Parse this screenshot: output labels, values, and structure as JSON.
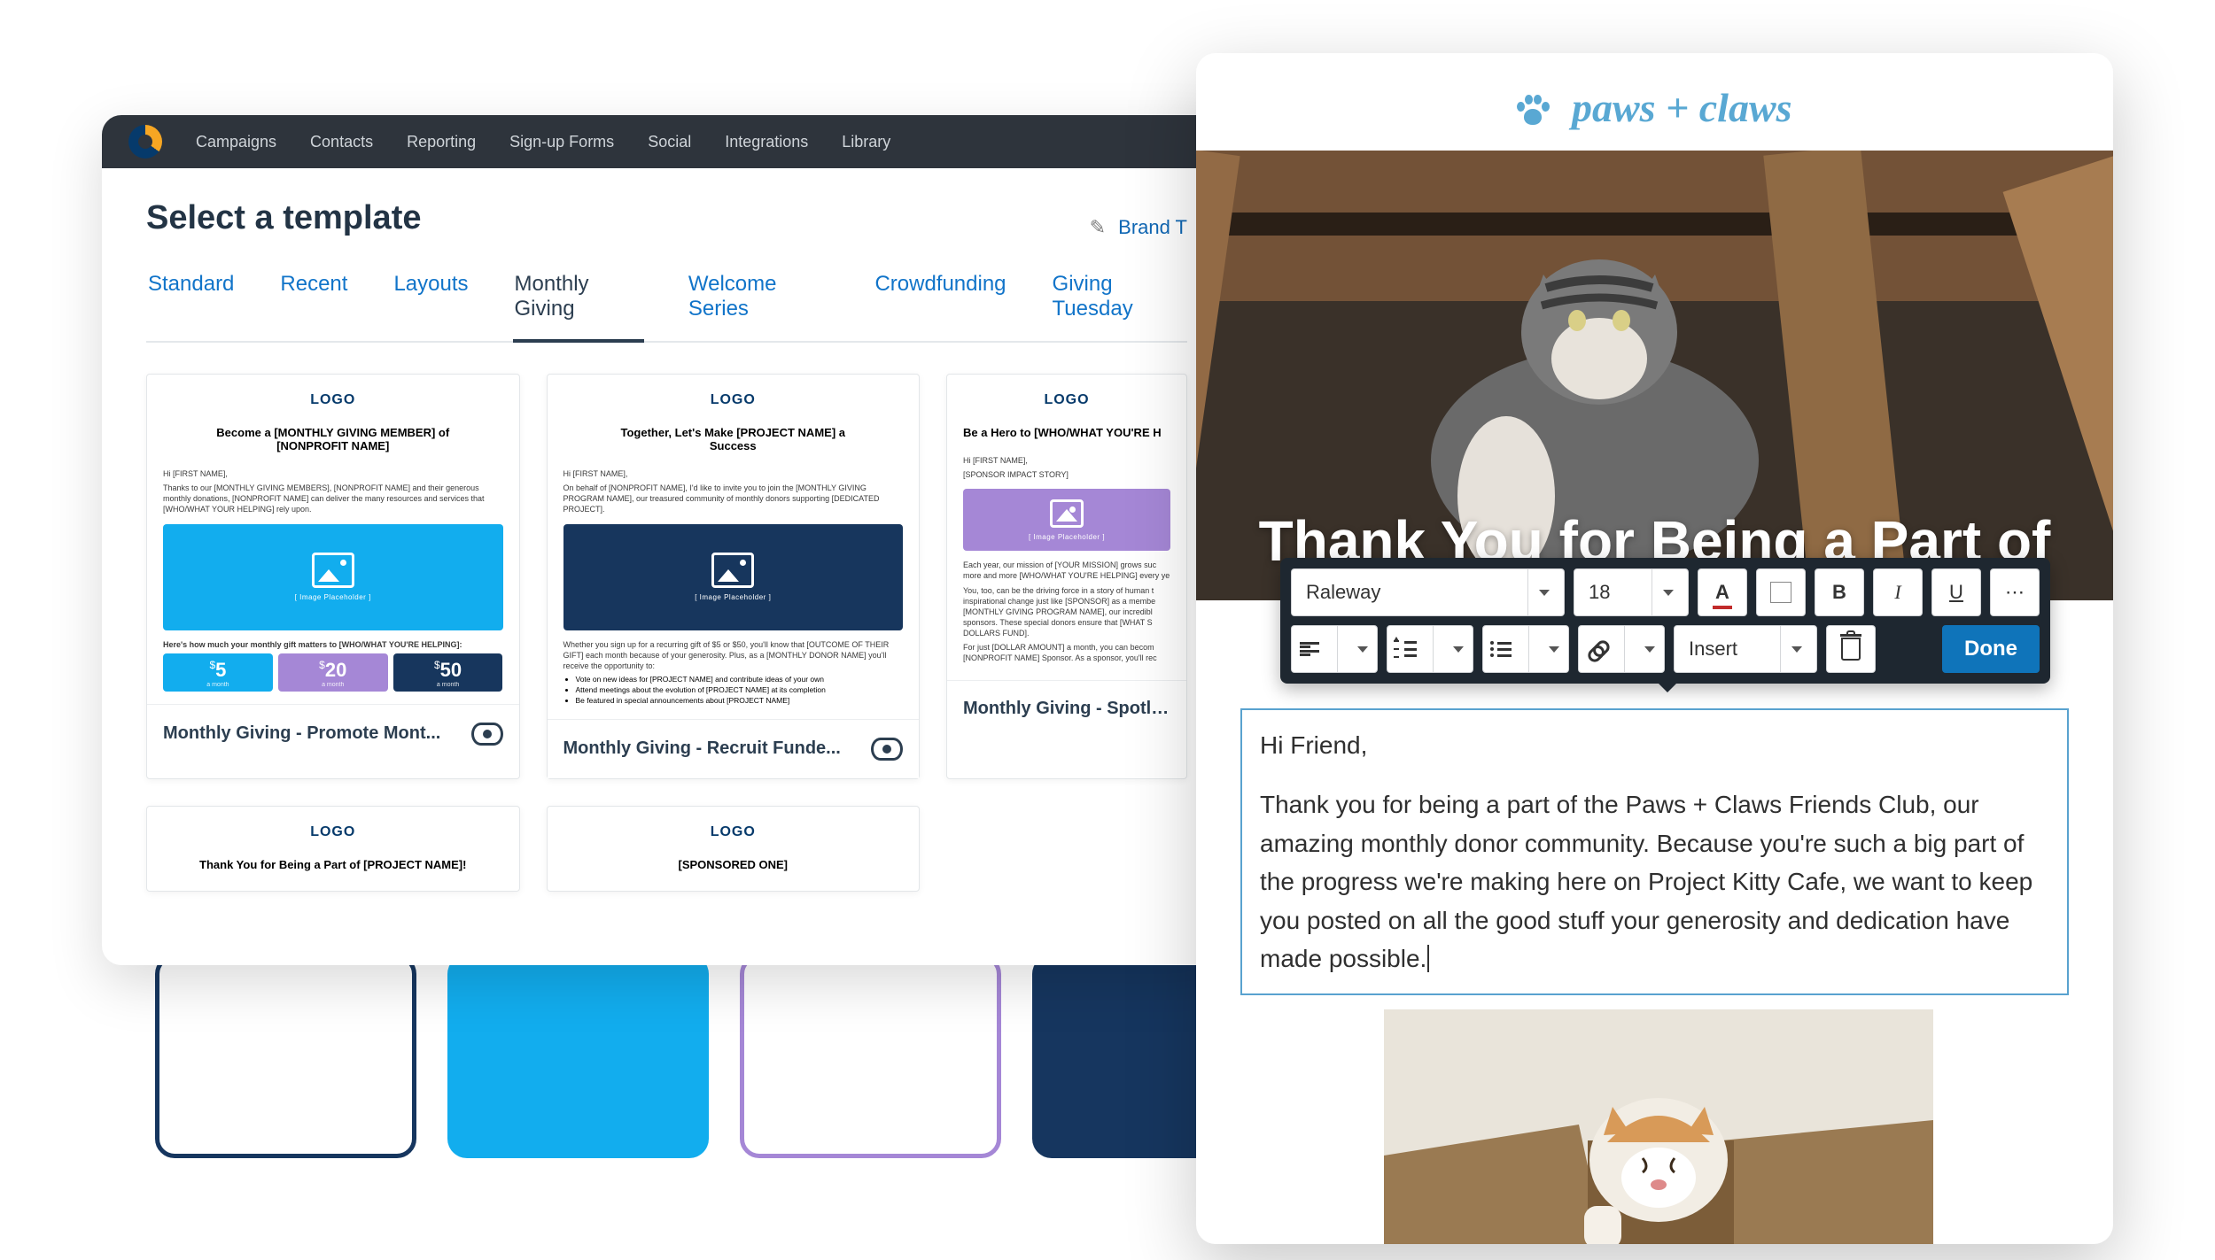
{
  "nav": {
    "items": [
      "Campaigns",
      "Contacts",
      "Reporting",
      "Sign-up Forms",
      "Social",
      "Integrations",
      "Library"
    ]
  },
  "picker": {
    "title": "Select a template",
    "brand_link": "Brand T",
    "tabs": [
      "Standard",
      "Recent",
      "Layouts",
      "Monthly Giving",
      "Welcome Series",
      "Crowdfunding",
      "Giving Tuesday"
    ],
    "active_tab": "Monthly Giving",
    "cards": [
      {
        "logo": "LOGO",
        "headline": "Become a [MONTHLY GIVING MEMBER] of [NONPROFIT NAME]",
        "greeting": "Hi [FIRST NAME],",
        "intro": "Thanks to our [MONTHLY GIVING MEMBERS], [NONPROFIT NAME] and their generous monthly donations, [NONPROFIT NAME] can deliver the many resources and services that [WHO/WHAT YOUR HELPING] rely upon.",
        "ph": "[ Image Placeholder ]",
        "sub": "Here's how much your monthly gift matters to [WHO/WHAT YOU'RE HELPING]:",
        "prices": [
          {
            "n": "5"
          },
          {
            "n": "20"
          },
          {
            "n": "50"
          }
        ],
        "price_unit": "a month",
        "name": "Monthly Giving - Promote Mont..."
      },
      {
        "logo": "LOGO",
        "headline": "Together, Let's Make [PROJECT NAME] a Success",
        "greeting": "Hi [FIRST NAME],",
        "intro": "On behalf of [NONPROFIT NAME], I'd like to invite you to join the [MONTHLY GIVING PROGRAM NAME], our treasured community of monthly donors supporting [DEDICATED PROJECT].",
        "ph": "[ Image Placeholder ]",
        "body": "Whether you sign up for a recurring gift of $5 or $50, you'll know that [OUTCOME OF THEIR GIFT] each month because of your generosity. Plus, as a [MONTHLY DONOR NAME] you'll receive the opportunity to:",
        "bullets": [
          "Vote on new ideas for [PROJECT NAME] and contribute ideas of your own",
          "Attend meetings about the evolution of [PROJECT NAME] at its completion",
          "Be featured in special announcements about [PROJECT NAME]"
        ],
        "name": "Monthly Giving - Recruit Funde..."
      },
      {
        "logo": "LOGO",
        "headline": "Be a Hero to [WHO/WHAT YOU'RE H",
        "greeting": "Hi [FIRST NAME],",
        "impact": "[SPONSOR IMPACT STORY]",
        "ph": "[ Image Placeholder ]",
        "body1": "Each year, our mission of [YOUR MISSION] grows suc more and more [WHO/WHAT YOU'RE HELPING] every ye",
        "body2": "You, too, can be the driving force in a story of human t inspirational change just like [SPONSOR] as a membe [MONTHLY GIVING PROGRAM NAME], our incredibl sponsors. These special donors ensure that [WHAT S DOLLARS FUND].",
        "body3": "For just [DOLLAR AMOUNT] a month, you can becom [NONPROFIT NAME] Sponsor. As a sponsor, you'll rec",
        "name": "Monthly Giving - Spotlight Spo"
      }
    ],
    "row2": [
      {
        "logo": "LOGO",
        "headline": "Thank You for Being a Part of [PROJECT NAME]!"
      },
      {
        "logo": "LOGO",
        "headline": "[SPONSORED ONE]"
      }
    ]
  },
  "editor": {
    "brand": "paws + claws",
    "hero_heading": "Thank You for Being a Part of",
    "toolbar": {
      "font": "Raleway",
      "size": "18",
      "insert": "Insert",
      "done": "Done",
      "bold": "B",
      "italic": "I",
      "underline": "U"
    },
    "text": {
      "greeting": "Hi Friend,",
      "body": "Thank you for being a part of the Paws + Claws Friends Club, our amazing monthly donor community. Because you're such a big part of the progress we're making here on Project Kitty Cafe, we want to keep you posted on all the good stuff your generosity and dedication have made possible."
    }
  }
}
